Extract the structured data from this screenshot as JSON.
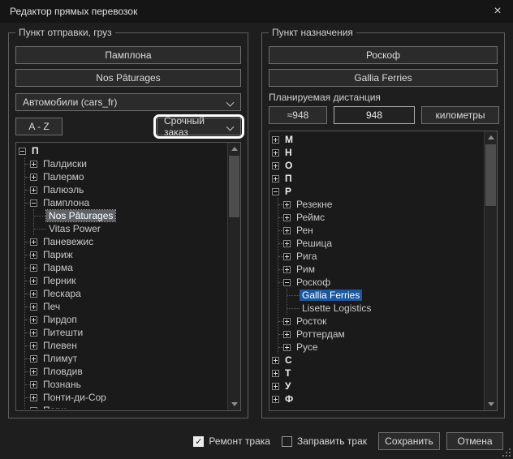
{
  "window": {
    "title": "Редактор прямых перевозок"
  },
  "icons": {
    "close": "×",
    "check": "✓"
  },
  "left_panel": {
    "group_label": "Пункт отправки, груз",
    "city_button": "Памплона",
    "company_button": "Nos Pâturages",
    "vehicle_dropdown": "Автомобили (cars_fr)",
    "az_button": "A - Z",
    "order_dropdown": "Срочный заказ",
    "tree": [
      {
        "label": "П",
        "state": "expanded",
        "children": [
          {
            "label": "Палдиски",
            "state": "collapsed"
          },
          {
            "label": "Палермо",
            "state": "collapsed"
          },
          {
            "label": "Палюэль",
            "state": "collapsed"
          },
          {
            "label": "Памплона",
            "state": "expanded",
            "children": [
              {
                "label": "Nos Pâturages",
                "state": "leaf",
                "selected": "gray"
              },
              {
                "label": "Vitas Power",
                "state": "leaf"
              }
            ]
          },
          {
            "label": "Паневежис",
            "state": "collapsed"
          },
          {
            "label": "Париж",
            "state": "collapsed"
          },
          {
            "label": "Парма",
            "state": "collapsed"
          },
          {
            "label": "Перник",
            "state": "collapsed"
          },
          {
            "label": "Пескара",
            "state": "collapsed"
          },
          {
            "label": "Печ",
            "state": "collapsed"
          },
          {
            "label": "Пирдоп",
            "state": "collapsed"
          },
          {
            "label": "Питешти",
            "state": "collapsed"
          },
          {
            "label": "Плевен",
            "state": "collapsed"
          },
          {
            "label": "Плимут",
            "state": "collapsed"
          },
          {
            "label": "Пловдив",
            "state": "collapsed"
          },
          {
            "label": "Познань",
            "state": "collapsed"
          },
          {
            "label": "Понти-ди-Сор",
            "state": "collapsed"
          },
          {
            "label": "Пори",
            "state": "collapsed"
          }
        ]
      }
    ]
  },
  "right_panel": {
    "group_label": "Пункт назначения",
    "city_button": "Роскоф",
    "company_button": "Gallia Ferries",
    "distance_label": "Планируемая дистанция",
    "distance_approx": "≈948",
    "distance_value": "948",
    "distance_unit": "километры",
    "tree": [
      {
        "label": "М",
        "state": "collapsed"
      },
      {
        "label": "Н",
        "state": "collapsed"
      },
      {
        "label": "О",
        "state": "collapsed"
      },
      {
        "label": "П",
        "state": "collapsed"
      },
      {
        "label": "Р",
        "state": "expanded",
        "children": [
          {
            "label": "Резекне",
            "state": "collapsed"
          },
          {
            "label": "Реймс",
            "state": "collapsed"
          },
          {
            "label": "Рен",
            "state": "collapsed"
          },
          {
            "label": "Решица",
            "state": "collapsed"
          },
          {
            "label": "Рига",
            "state": "collapsed"
          },
          {
            "label": "Рим",
            "state": "collapsed"
          },
          {
            "label": "Роскоф",
            "state": "expanded",
            "children": [
              {
                "label": "Gallia Ferries",
                "state": "leaf",
                "selected": "blue"
              },
              {
                "label": "Lisette Logistics",
                "state": "leaf"
              }
            ]
          },
          {
            "label": "Росток",
            "state": "collapsed"
          },
          {
            "label": "Роттердам",
            "state": "collapsed"
          },
          {
            "label": "Русе",
            "state": "collapsed"
          }
        ]
      },
      {
        "label": "С",
        "state": "collapsed"
      },
      {
        "label": "Т",
        "state": "collapsed"
      },
      {
        "label": "У",
        "state": "collapsed"
      },
      {
        "label": "Ф",
        "state": "collapsed"
      }
    ]
  },
  "footer": {
    "repair_label": "Ремонт трака",
    "repair_checked": true,
    "refuel_label": "Заправить трак",
    "refuel_checked": false,
    "save_label": "Сохранить",
    "cancel_label": "Отмена"
  },
  "colors": {
    "selection_blue": "#1c57a0",
    "selection_gray": "#5d6165",
    "highlight_ring": "#ffffff",
    "window_bg": "#1e1e1e"
  }
}
